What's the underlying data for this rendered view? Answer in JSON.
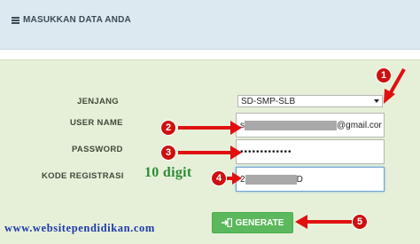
{
  "header": {
    "title": "MASUKKAN DATA ANDA",
    "icon": "list-icon"
  },
  "form": {
    "jenjang": {
      "label": "JENJANG",
      "selected": "SD-SMP-SLB"
    },
    "username": {
      "label": "USER NAME",
      "prefix": "s",
      "suffix": "@gmail.cor"
    },
    "password": {
      "label": "PASSWORD",
      "value": "•••••••••••••"
    },
    "kode": {
      "label": "KODE REGISTRASI",
      "prefix": "2",
      "suffix": "D"
    },
    "generate_label": "GENERATE",
    "generate_icon": "login-icon"
  },
  "annotations": {
    "digit_note": "10 digit",
    "watermark": "www.websitependidikan.com",
    "steps": [
      "1",
      "2",
      "3",
      "4",
      "5"
    ],
    "arrow_color": "#e01010"
  },
  "colors": {
    "button": "#5cb85c",
    "form_bg": "#e6f0d8",
    "header_bg": "#dde9f0",
    "watermark": "#1d3aa8",
    "digit_note": "#2e8a35"
  }
}
